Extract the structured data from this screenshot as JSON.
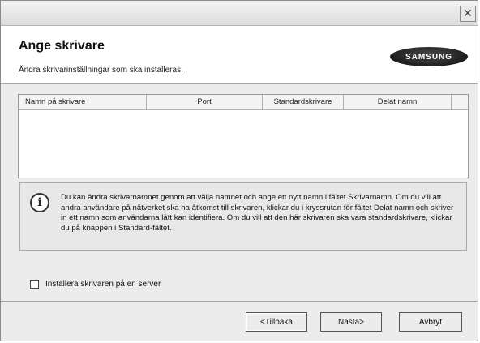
{
  "window": {
    "close_symbol": "✕"
  },
  "header": {
    "title": "Ange skrivare",
    "subtitle": "Ändra skrivarinställningar som ska installeras.",
    "logo_text": "SAMSUNG"
  },
  "printer_table": {
    "columns": [
      "Namn på skrivare",
      "Port",
      "Standardskrivare",
      "Delat namn",
      ""
    ],
    "rows": []
  },
  "info": {
    "icon": "info-icon",
    "text": "Du kan ändra skrivarnamnet genom att välja namnet och ange ett nytt namn i fältet Skrivarnamn. Om du vill att andra användare på nätverket ska ha åtkomst till skrivaren, klickar du i kryssrutan för fältet Delat namn och skriver in ett namn som användarna lätt kan identifiera. Om du vill att den här skrivaren ska vara standardskrivare, klickar du på knappen i Standard-fältet."
  },
  "server_option": {
    "label": "Installera skrivaren på en server",
    "checked": false
  },
  "buttons": {
    "back": "<Tillbaka",
    "next": "Nästa>",
    "cancel": "Avbryt"
  }
}
